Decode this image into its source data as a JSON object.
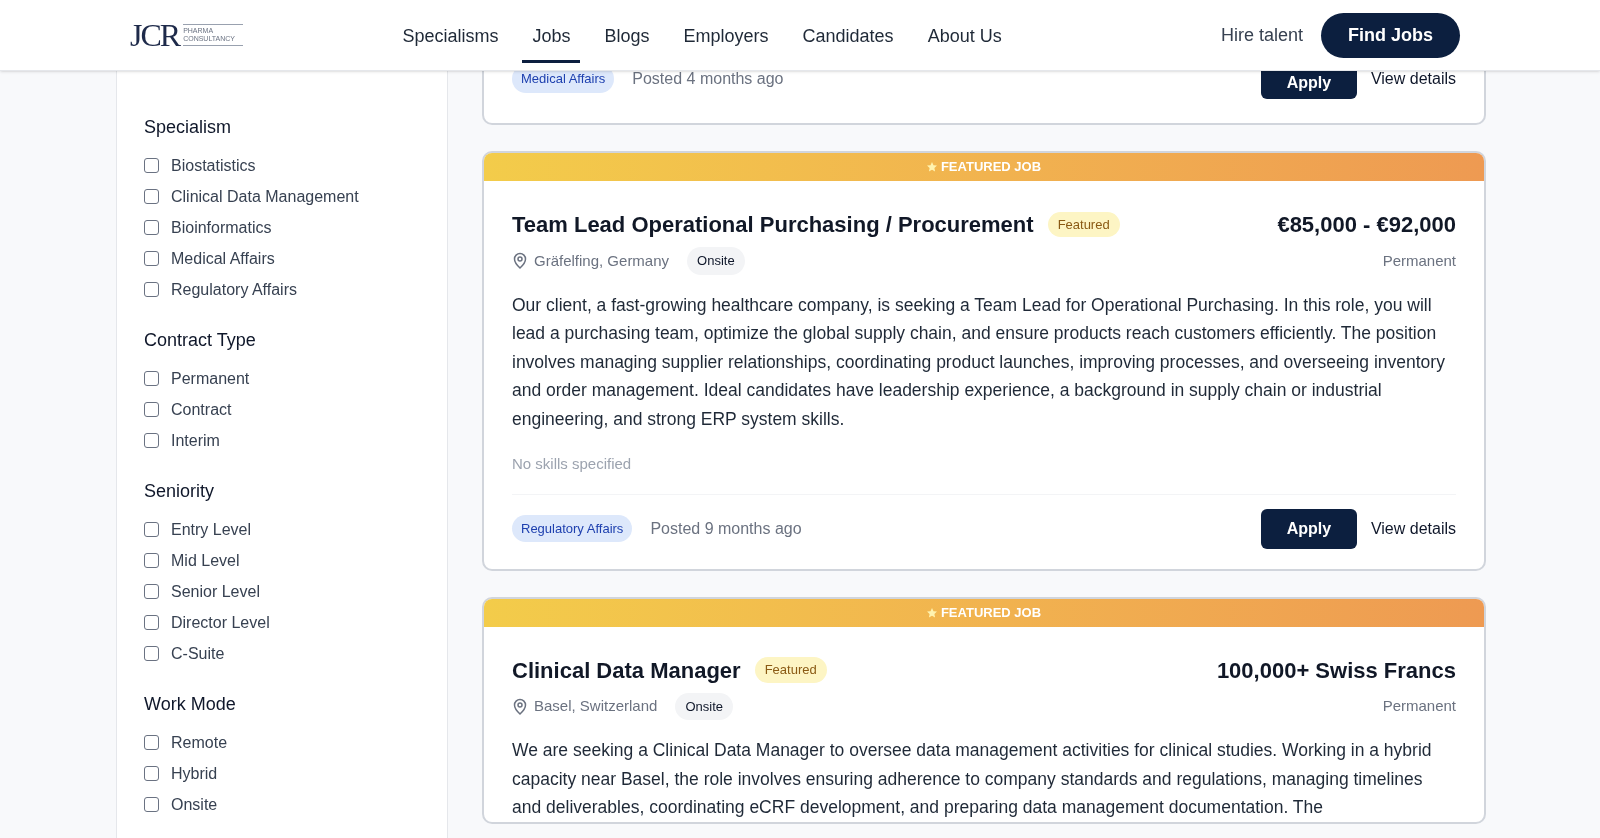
{
  "header": {
    "logo": "JCR",
    "logo_sub": "PHARMA CONSULTANCY",
    "nav": [
      {
        "label": "Specialisms",
        "selected": false
      },
      {
        "label": "Jobs",
        "selected": true
      },
      {
        "label": "Blogs",
        "selected": false
      },
      {
        "label": "Employers",
        "selected": false
      },
      {
        "label": "Candidates",
        "selected": false
      },
      {
        "label": "About Us",
        "selected": false
      }
    ],
    "hire_link": "Hire talent",
    "cta": "Find Jobs"
  },
  "filters": {
    "groups": [
      {
        "title": "Specialism",
        "options": [
          {
            "label": "Biostatistics",
            "checked": false
          },
          {
            "label": "Clinical Data Management",
            "checked": false
          },
          {
            "label": "Bioinformatics",
            "checked": false
          },
          {
            "label": "Medical Affairs",
            "checked": false
          },
          {
            "label": "Regulatory Affairs",
            "checked": false
          }
        ]
      },
      {
        "title": "Contract Type",
        "options": [
          {
            "label": "Permanent",
            "checked": false
          },
          {
            "label": "Contract",
            "checked": false
          },
          {
            "label": "Interim",
            "checked": false
          }
        ]
      },
      {
        "title": "Seniority",
        "options": [
          {
            "label": "Entry Level",
            "checked": false
          },
          {
            "label": "Mid Level",
            "checked": false
          },
          {
            "label": "Senior Level",
            "checked": false
          },
          {
            "label": "Director Level",
            "checked": false
          },
          {
            "label": "C-Suite",
            "checked": false
          }
        ]
      },
      {
        "title": "Work Mode",
        "options": [
          {
            "label": "Remote",
            "checked": false
          },
          {
            "label": "Hybrid",
            "checked": false
          },
          {
            "label": "Onsite",
            "checked": false
          }
        ]
      }
    ]
  },
  "jobs": [
    {
      "kind": "partial",
      "tag": "Medical Affairs",
      "posted": "Posted 4 months ago",
      "apply": "Apply",
      "view": "View details"
    },
    {
      "kind": "featured",
      "banner": "FEATURED JOB",
      "title": "Team Lead Operational Purchasing / Procurement",
      "badge": "Featured",
      "salary": "€85,000 - €92,000",
      "contract": "Permanent",
      "location": "Gräfelfing, Germany",
      "work_mode": "Onsite",
      "description": "Our client, a fast-growing healthcare company, is seeking a Team Lead for Operational Purchasing. In this role, you will lead a purchasing team, optimize the global supply chain, and ensure products reach customers efficiently. The position involves managing supplier relationships, coordinating product launches, improving processes, and overseeing inventory and order management. Ideal candidates have leadership experience, a background in supply chain or industrial engineering, and strong ERP system skills.",
      "skills": "No skills specified",
      "tag": "Regulatory Affairs",
      "posted": "Posted 9 months ago",
      "apply": "Apply",
      "view": "View details"
    },
    {
      "kind": "featured",
      "banner": "FEATURED JOB",
      "title": "Clinical Data Manager",
      "badge": "Featured",
      "salary": "100,000+ Swiss Francs",
      "contract": "Permanent",
      "location": "Basel, Switzerland",
      "work_mode": "Onsite",
      "description": "We are seeking a Clinical Data Manager to oversee data management activities for clinical studies. Working in a hybrid capacity near Basel, the role involves ensuring adherence to company standards and regulations, managing timelines and deliverables, coordinating eCRF development, and preparing data management documentation. The"
    }
  ]
}
